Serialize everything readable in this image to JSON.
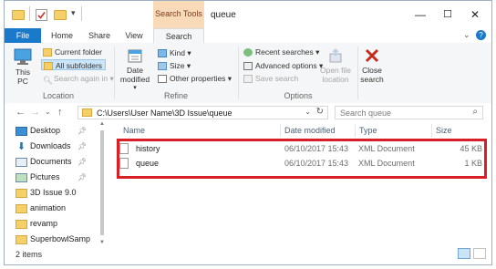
{
  "title_bar": {
    "window_title": "queue",
    "context_tab_label": "Search Tools",
    "minimize_glyph": "—",
    "maximize_glyph": "☐",
    "close_glyph": "✕"
  },
  "ribbon_tabs": {
    "file": "File",
    "home": "Home",
    "share": "Share",
    "view": "View",
    "search": "Search",
    "collapse_glyph": "⌄",
    "help_glyph": "?"
  },
  "ribbon": {
    "location": {
      "this_pc": "This PC",
      "current_folder": "Current folder",
      "all_subfolders": "All subfolders",
      "search_again_in": "Search again in",
      "label": "Location"
    },
    "refine": {
      "date_modified": "Date modified",
      "kind": "Kind",
      "size": "Size",
      "other_properties": "Other properties",
      "label": "Refine"
    },
    "options": {
      "recent_searches": "Recent searches",
      "advanced_options": "Advanced options",
      "save_search": "Save search",
      "open_file_location": "Open file location",
      "label": "Options"
    },
    "close_search": "Close search"
  },
  "address_bar": {
    "path": "C:\\Users\\User Name\\3D Issue\\queue",
    "search_placeholder": "Search queue"
  },
  "nav_pane": {
    "items": [
      {
        "label": "Desktop",
        "icon": "desktop-icon",
        "pinned": true
      },
      {
        "label": "Downloads",
        "icon": "download-icon",
        "pinned": true
      },
      {
        "label": "Documents",
        "icon": "documents-icon",
        "pinned": true
      },
      {
        "label": "Pictures",
        "icon": "pictures-icon",
        "pinned": true
      },
      {
        "label": "3D Issue 9.0",
        "icon": "folder-icon",
        "pinned": false
      },
      {
        "label": "animation",
        "icon": "folder-icon",
        "pinned": false
      },
      {
        "label": "revamp",
        "icon": "folder-icon",
        "pinned": false
      },
      {
        "label": "SuperbowlSamp",
        "icon": "folder-icon",
        "pinned": false
      }
    ]
  },
  "file_list": {
    "columns": {
      "name": "Name",
      "date": "Date modified",
      "type": "Type",
      "size": "Size"
    },
    "rows": [
      {
        "name": "history",
        "date": "06/10/2017 15:43",
        "type": "XML Document",
        "size": "45 KB"
      },
      {
        "name": "queue",
        "date": "06/10/2017 15:43",
        "type": "XML Document",
        "size": "1 KB"
      }
    ]
  },
  "status_bar": {
    "item_count": "2 items"
  },
  "colors": {
    "file_tab": "#1979ca",
    "context_tab": "#f8dab9",
    "highlight_box": "#d81f26",
    "folder": "#f5cf67"
  }
}
